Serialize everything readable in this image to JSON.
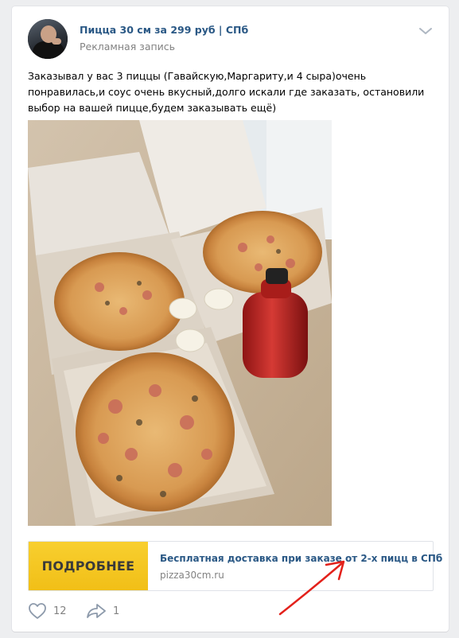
{
  "post": {
    "author": "Пицца 30 см за 299 руб | СПб",
    "label": "Рекламная запись",
    "text": "Заказывал у вас 3 пиццы (Гавайскую,Маргариту,и 4 сыра)очень понравилась,и соус очень вкусный,долго искали где заказать, остановили выбор на вашей пицце,будем заказывать ещё)",
    "icons": {
      "menu": "chevron-down-icon",
      "like": "heart-icon",
      "share": "share-arrow-icon"
    }
  },
  "snippet": {
    "button_label": "ПОДРОБНЕЕ",
    "title": "Бесплатная доставка при заказе от 2-х пицц в СПб",
    "domain": "pizza30cm.ru"
  },
  "footer": {
    "likes": "12",
    "shares": "1"
  },
  "colors": {
    "background": "#edeef0",
    "link": "#2a5885",
    "muted": "#828282",
    "button": "#f5c21d",
    "annotation_arrow": "#e3211b"
  }
}
